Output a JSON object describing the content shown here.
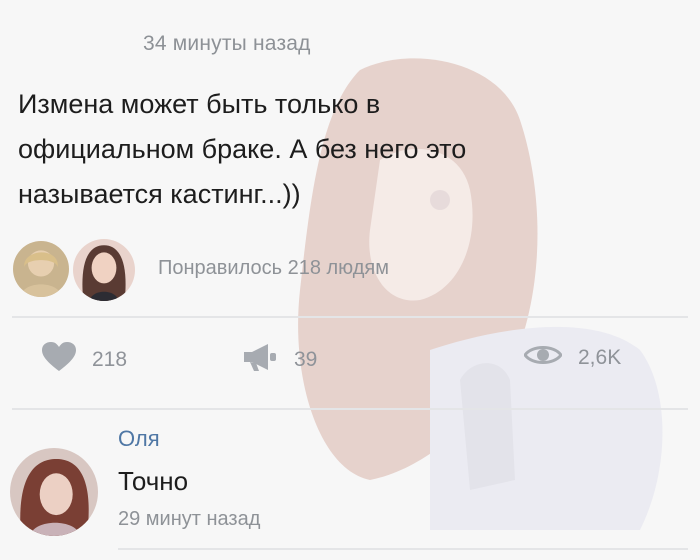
{
  "post": {
    "timestamp": "34 минуты назад",
    "text_lines": [
      "Измена может быть только в",
      "официальном браке. А без него это",
      "называется кастинг...))"
    ],
    "liked_by_text": "Понравилось 218 людям"
  },
  "stats": {
    "likes": "218",
    "shares": "39",
    "views": "2,6K"
  },
  "comment": {
    "author": "Оля",
    "text": "Точно",
    "time": "29 минут назад"
  },
  "colors": {
    "author_link": "#4f77a5",
    "muted": "#8e9297",
    "divider": "#e4e5e7"
  }
}
